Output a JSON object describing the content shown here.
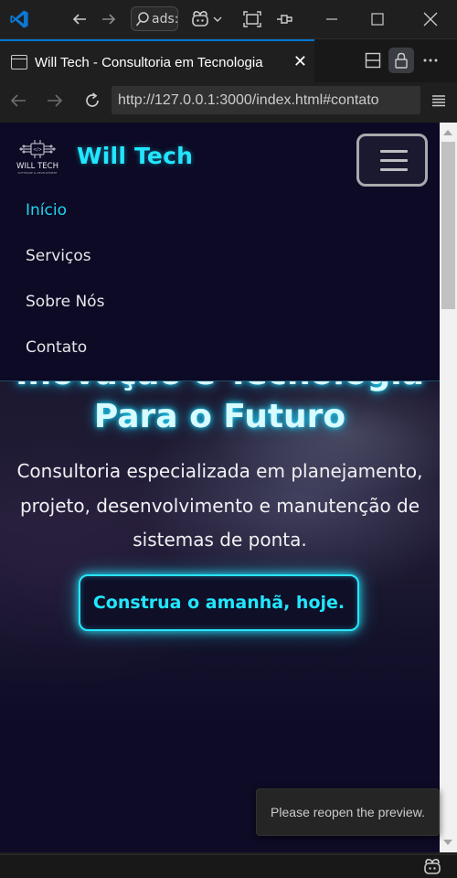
{
  "titlebar": {
    "command_center_text": "ads:",
    "icons": [
      "vscode-logo",
      "back-arrow",
      "forward-arrow",
      "search",
      "copilot",
      "chevron-down",
      "toggle-layout",
      "pin",
      "minimize",
      "maximize",
      "close"
    ]
  },
  "tab": {
    "title": "Will Tech - Consultoria em Tecnologia",
    "close_glyph": "✕"
  },
  "browser": {
    "url": "http://127.0.0.1:3000/index.html#contato"
  },
  "site": {
    "logo_text": "WILL TECH",
    "logo_tagline": "SOFTWARE & DEVELOPMENT",
    "brand_name": "Will Tech",
    "nav": [
      {
        "label": "Início",
        "active": true
      },
      {
        "label": "Serviços",
        "active": false
      },
      {
        "label": "Sobre Nós",
        "active": false
      },
      {
        "label": "Contato",
        "active": false
      }
    ],
    "hero": {
      "title_line_1": "Inovação e Tecnologia",
      "title_line_2": "Para o Futuro",
      "subtitle_lines": [
        "Consultoria especializada em planejamento,",
        "projeto, desenvolvimento e manutenção de",
        "sistemas de ponta."
      ],
      "cta_label": "Construa o amanhã, hoje."
    }
  },
  "notification": {
    "message": "Please reopen the preview."
  },
  "colors": {
    "accent_cyan": "#22e6ff",
    "vscode_blue": "#0078d4",
    "page_bg": "#0d0b26"
  }
}
